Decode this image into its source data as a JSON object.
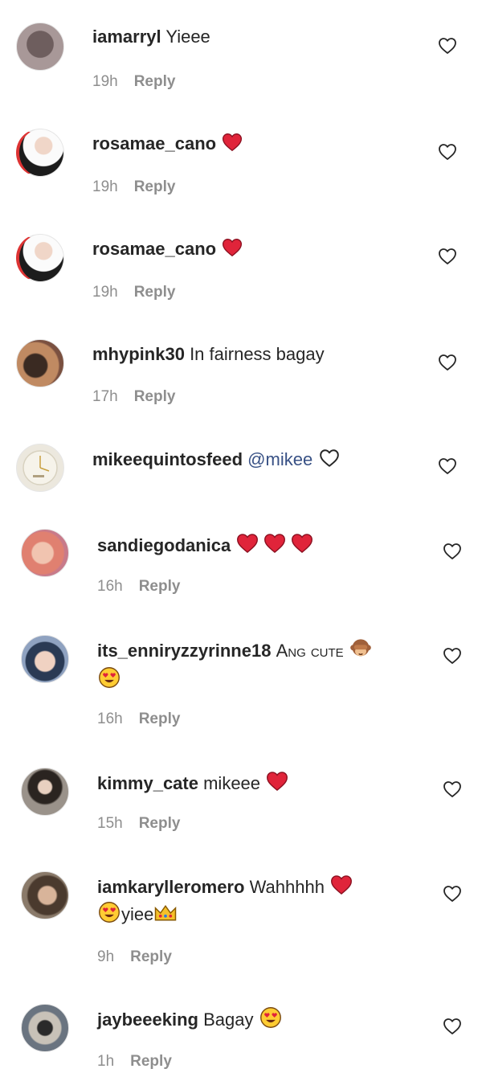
{
  "comments": [
    {
      "username": "iamarryl",
      "text": "Yieee",
      "time": "19h",
      "reply": "Reply",
      "avatar": "#8a7e7f"
    },
    {
      "username": "rosamae_cano",
      "text": "",
      "emoji": [
        "red-heart-icon"
      ],
      "time": "19h",
      "reply": "Reply",
      "avatar": "#2a2a2a"
    },
    {
      "username": "rosamae_cano",
      "text": "",
      "emoji": [
        "red-heart-icon"
      ],
      "time": "19h",
      "reply": "Reply",
      "avatar": "#2a2a2a"
    },
    {
      "username": "mhypink30",
      "text": "In fairness bagay",
      "time": "17h",
      "reply": "Reply",
      "avatar": "#7a5a46"
    },
    {
      "username": "mikeequintosfeed",
      "mention": "@mikee",
      "emoji": [
        "white-heart-icon"
      ],
      "time": "",
      "reply": "",
      "avatar": "#e8e4d8"
    },
    {
      "username": "sandiegodanica",
      "text": "",
      "emoji": [
        "red-heart-icon",
        "red-heart-icon",
        "red-heart-icon"
      ],
      "time": "16h",
      "reply": "Reply",
      "avatar": "#d99a8c"
    },
    {
      "username": "its_enniryzzyrinne18",
      "text": "Ang cute",
      "emoji": [
        "see-no-evil-monkey-icon"
      ],
      "line2_emoji": [
        "heart-eyes-icon"
      ],
      "time": "16h",
      "reply": "Reply",
      "avatar": "#3c5a78"
    },
    {
      "username": "kimmy_cate",
      "text": "mikeee",
      "emoji": [
        "red-heart-icon"
      ],
      "time": "15h",
      "reply": "Reply",
      "avatar": "#5a5048"
    },
    {
      "username": "iamkarylleromero",
      "text": "Wahhhhh",
      "emoji": [
        "red-heart-icon"
      ],
      "line2_text": "yiee",
      "line2_emoji": [
        "heart-eyes-icon",
        "crown-icon"
      ],
      "time": "9h",
      "reply": "Reply",
      "avatar": "#6b5a4a"
    },
    {
      "username": "jaybeeeking",
      "text": "Bagay",
      "emoji": [
        "heart-eyes-icon"
      ],
      "time": "1h",
      "reply": "Reply",
      "avatar": "#5c6470"
    }
  ],
  "colors": {
    "text": "#262626",
    "meta": "#8e8e8e",
    "mention": "#385185",
    "heart": "#ed4956"
  }
}
